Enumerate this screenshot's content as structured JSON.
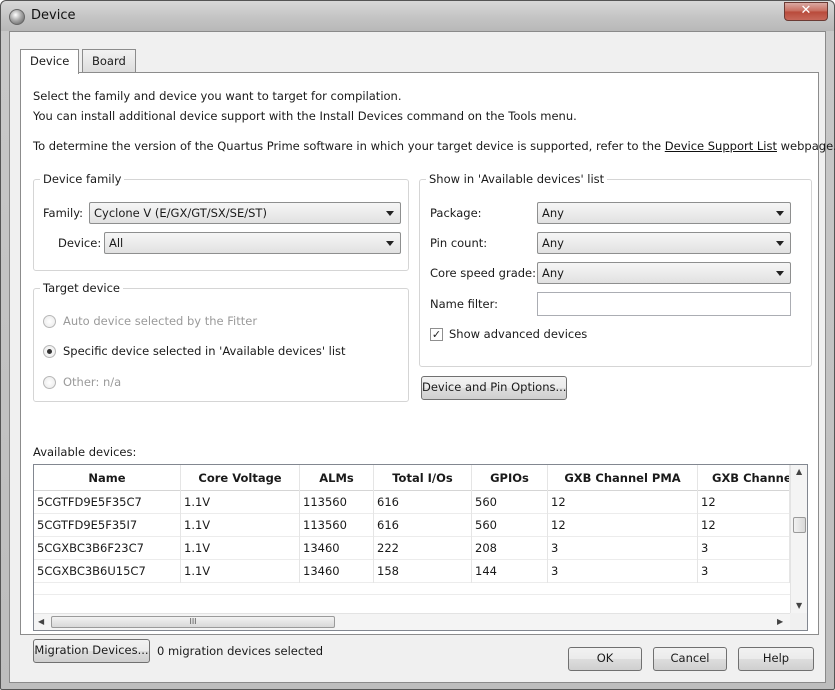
{
  "window": {
    "title": "Device",
    "close_glyph": "✕"
  },
  "tabs": [
    {
      "label": "Device"
    },
    {
      "label": "Board"
    }
  ],
  "intro": {
    "line1": "Select the family and device you want to target for compilation.",
    "line2": "You can install additional device support with the Install Devices command on the Tools menu.",
    "line3_prefix": "To determine the version of the Quartus Prime software in which your target device is supported, refer to the",
    "line3_link": "Device Support List",
    "line3_suffix": "webpage."
  },
  "device_family": {
    "legend": "Device family",
    "family_label": "Family:",
    "family_value": "Cyclone V (E/GX/GT/SX/SE/ST)",
    "device_label": "Device:",
    "device_value": "All"
  },
  "target_device": {
    "legend": "Target device",
    "option_auto": "Auto device selected by the Fitter",
    "option_specific": "Specific device selected in 'Available devices' list",
    "option_other": "Other:  n/a",
    "selected": "specific"
  },
  "show_in": {
    "legend": "Show in 'Available devices' list",
    "package_label": "Package:",
    "package_value": "Any",
    "pin_count_label": "Pin count:",
    "pin_count_value": "Any",
    "speed_label": "Core speed grade:",
    "speed_value": "Any",
    "name_filter_label": "Name filter:",
    "name_filter_value": "",
    "show_advanced_label": "Show advanced devices",
    "show_advanced_checked": true
  },
  "device_pin_options_button": "Device and Pin Options...",
  "available_devices": {
    "label": "Available devices:",
    "columns": [
      "Name",
      "Core Voltage",
      "ALMs",
      "Total I/Os",
      "GPIOs",
      "GXB Channel PMA",
      "GXB Channel P"
    ],
    "rows": [
      [
        "5CGTFD9E5F35C7",
        "1.1V",
        "113560",
        "616",
        "560",
        "12",
        "12"
      ],
      [
        "5CGTFD9E5F35I7",
        "1.1V",
        "113560",
        "616",
        "560",
        "12",
        "12"
      ],
      [
        "5CGXBC3B6F23C7",
        "1.1V",
        "13460",
        "222",
        "208",
        "3",
        "3"
      ],
      [
        "5CGXBC3B6U15C7",
        "1.1V",
        "13460",
        "158",
        "144",
        "3",
        "3"
      ]
    ],
    "hthumb_glyph": "III"
  },
  "migration": {
    "button": "Migration Devices...",
    "status": "0 migration devices selected"
  },
  "footer": {
    "ok": "OK",
    "cancel": "Cancel",
    "help": "Help"
  }
}
